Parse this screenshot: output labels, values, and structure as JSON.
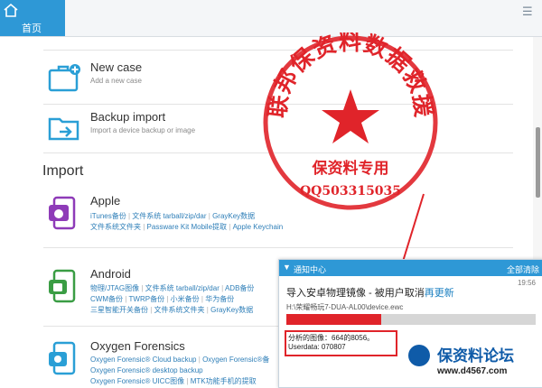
{
  "header": {
    "home_label": "首页",
    "menu_icon": "menu-icon"
  },
  "actions": [
    {
      "title": "New case",
      "subtitle": "Add a new case",
      "icon": "briefcase-plus-icon"
    },
    {
      "title": "Backup import",
      "subtitle": "Import a device backup or image",
      "icon": "folder-import-icon"
    }
  ],
  "import_section": {
    "heading": "Import",
    "sources": [
      {
        "title": "Apple",
        "icon": "apple-device-icon",
        "links": [
          [
            "iTunes备份",
            "文件系统 tarball/zip/dar",
            "GrayKey数据"
          ],
          [
            "文件系统文件夹",
            "Passware Kit Mobile提取",
            "Apple Keychain"
          ]
        ]
      },
      {
        "title": "Android",
        "icon": "android-device-icon",
        "links": [
          [
            "物理/JTAG图像",
            "文件系统 tarball/zip/dar",
            "ADB备份"
          ],
          [
            "CWM备份",
            "TWRP备份",
            "小米备份",
            "华为备份"
          ],
          [
            "三星智能开关备份",
            "文件系统文件夹",
            "GrayKey数据"
          ]
        ]
      },
      {
        "title": "Oxygen Forensics",
        "icon": "oxygen-device-icon",
        "links": [
          [
            "Oxygen Forensic® Cloud backup",
            "Oxygen Forensic®备"
          ],
          [
            "Oxygen Forensic® desktop backup"
          ],
          [
            "Oxygen Forensic® UICC图像",
            "MTK功能手机的提取"
          ]
        ]
      }
    ]
  },
  "stamp": {
    "arc_text": "联邦保资料数据救援",
    "line1": "保资料专用",
    "line2": "QQ503315035"
  },
  "notification": {
    "header_title": "通知中心",
    "clear_all": "全部清除",
    "message": "导入安卓物理镜像 - 被用户取消",
    "action": "再更新",
    "time": "19:56",
    "path": "H:\\荣耀畅玩7-DUA-AL00\\device.ewc",
    "progress": 0.38,
    "analyzed_images": "分析的图像：664的8056。",
    "userdata": "Userdata: 070807",
    "accent": "#2e98d6",
    "highlight": "#e0242a"
  },
  "watermark": {
    "title": "保资料论坛",
    "url": "www.d4567.com"
  }
}
